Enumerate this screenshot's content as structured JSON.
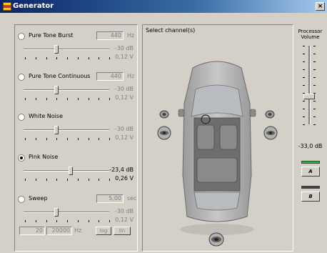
{
  "window": {
    "title": "Generator",
    "close_glyph": "×"
  },
  "signals": [
    {
      "id": "pure-tone-burst",
      "label": "Pure Tone Burst",
      "value": "440",
      "unit": "Hz",
      "level_db": "-30 dB",
      "level_v": "0,12 V",
      "slider_fraction": 0.38,
      "selected": false
    },
    {
      "id": "pure-tone-continuous",
      "label": "Pure Tone Continuous",
      "value": "440",
      "unit": "Hz",
      "level_db": "-30 dB",
      "level_v": "0,12 V",
      "slider_fraction": 0.38,
      "selected": false
    },
    {
      "id": "white-noise",
      "label": "White Noise",
      "level_db": "-30 dB",
      "level_v": "0,12 V",
      "slider_fraction": 0.38,
      "selected": false
    },
    {
      "id": "pink-noise",
      "label": "Pink Noise",
      "level_db": "-23,4 dB",
      "level_v": "0,26 V",
      "slider_fraction": 0.55,
      "selected": true
    },
    {
      "id": "sweep",
      "label": "Sweep",
      "value": "5,00",
      "unit": "sec",
      "level_db": "-30 dB",
      "level_v": "0,12 V",
      "slider_fraction": 0.38,
      "selected": false
    }
  ],
  "sweep_range": {
    "from": "20",
    "to": "20000",
    "unit": "Hz",
    "log_label": "log",
    "lin_label": "lin"
  },
  "center": {
    "title": "Select channel(s)"
  },
  "processor": {
    "label_line1": "Processor",
    "label_line2": "Volume",
    "volume": "-33,0 dB",
    "button_a": "A",
    "button_b": "B",
    "led_a_color": "#1fbf3a",
    "led_b_color": "#404040"
  },
  "icons": {
    "app": "generator-icon",
    "close": "close-icon",
    "speaker": "speaker-icon",
    "car": "car-top-view-icon"
  }
}
